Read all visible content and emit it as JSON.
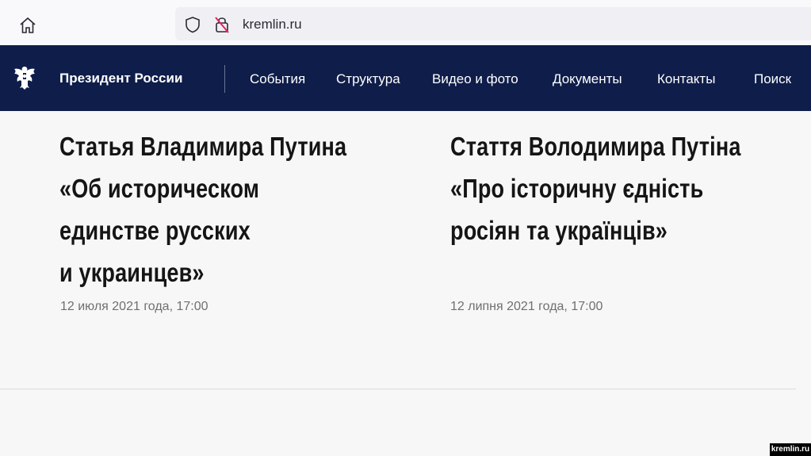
{
  "browser": {
    "url": "kremlin.ru"
  },
  "nav": {
    "brand": "Президент России",
    "items": [
      "События",
      "Структура",
      "Видео и фото",
      "Документы",
      "Контакты",
      "Поиск"
    ]
  },
  "articles": [
    {
      "title_lines": [
        "Статья Владимира Путина",
        "«Об историческом",
        "единстве русских",
        "и украинцев»"
      ],
      "date": "12 июля 2021 года, 17:00"
    },
    {
      "title_lines": [
        "Стаття Володимира Путіна",
        "«Про історичну єдність",
        "росіян та українців»"
      ],
      "date": "12 липня 2021 года, 17:00"
    }
  ],
  "watermark": "kremlin.ru"
}
